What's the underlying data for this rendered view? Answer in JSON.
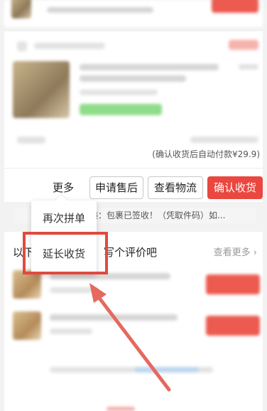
{
  "order": {
    "auto_pay_note": "(确认收货后自动付款¥29.9)"
  },
  "actions": {
    "more": "更多",
    "after_sale": "申请售后",
    "logistics": "查看物流",
    "confirm_receipt": "确认收货"
  },
  "more_menu": {
    "items": [
      {
        "label": "再次拼单"
      },
      {
        "label": "延长收货"
      }
    ]
  },
  "logistics_status": "递：包裹已签收！（凭取件码）如...",
  "reviews": {
    "title_left": "以下",
    "title_right": "写个评价吧",
    "see_more": "查看更多",
    "see_more_chevron": "chevron-right-icon"
  },
  "colors": {
    "accent": "#e9473f",
    "highlight": "#e04a3f",
    "arrow": "#e5695e"
  }
}
